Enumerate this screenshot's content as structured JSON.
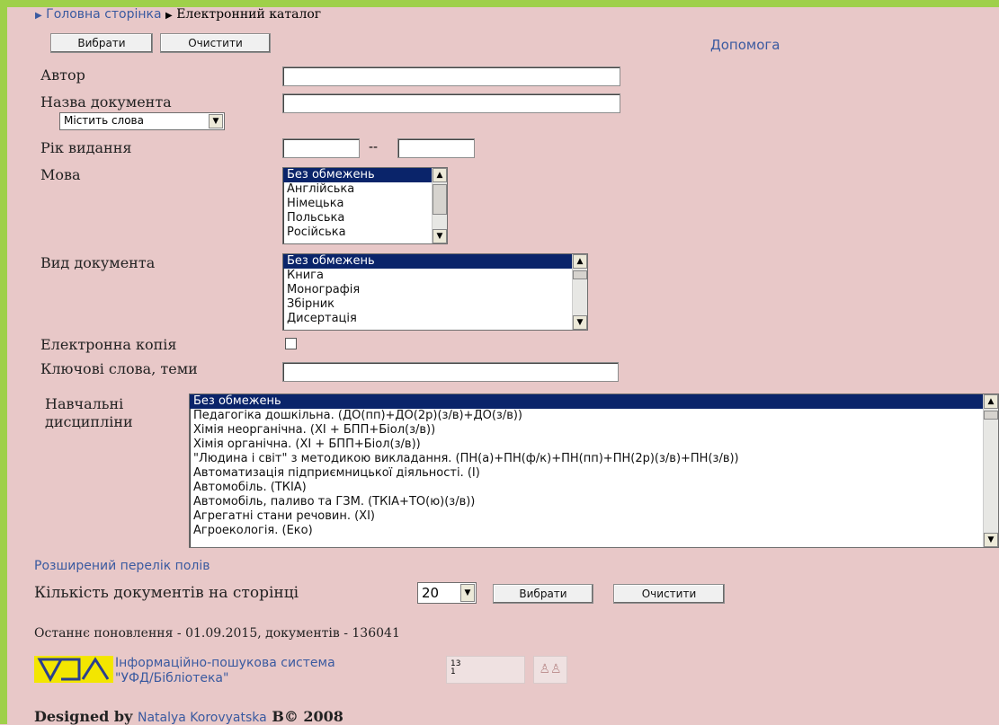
{
  "breadcrumb": {
    "home": "Головна сторінка",
    "current": "Електронний каталог"
  },
  "toolbar": {
    "select_label": "Вибрати",
    "clear_label": "Очистити",
    "help_label": "Допомога"
  },
  "fields": {
    "author_label": "Автор",
    "title_label": "Назва документа",
    "title_mode": "Містить слова",
    "year_label": "Рік видання",
    "year_sep": "--",
    "language_label": "Мова",
    "doctype_label": "Вид документа",
    "ecopy_label": "Електронна копія",
    "keywords_label": "Ключові слова, теми",
    "disciplines_label_line1": "Навчальні",
    "disciplines_label_line2": "дисципліни"
  },
  "languages": [
    "Без обмежень",
    "Англійська",
    "Німецька",
    "Польська",
    "Російська"
  ],
  "doctypes": [
    "Без обмежень",
    "Книга",
    "Монографія",
    "Збірник",
    "Дисертація"
  ],
  "disciplines": [
    "Без обмежень",
    "Педагогіка дошкільна. (ДО(пп)+ДО(2р)(з/в)+ДО(з/в))",
    "Хімія неорганічна. (ХІ + БПП+Біол(з/в))",
    "Хімія органічна. (ХІ + БПП+Біол(з/в))",
    "\"Людина і світ\" з методикою викладання. (ПН(а)+ПН(ф/к)+ПН(пп)+ПН(2р)(з/в)+ПН(з/в))",
    "Автоматизація підприємницької діяльності. (І)",
    "Автомобіль. (ТКІА)",
    "Автомобіль, паливо та ГЗМ. (ТКІА+ТО(ю)(з/в))",
    "Агрегатні стани речовин. (ХІ)",
    "Агроекологія. (Еко)"
  ],
  "extended_link": "Розширений перелік полів",
  "page_size": {
    "label": "Кількість документів на сторінці",
    "value": "20"
  },
  "bottom": {
    "select_label": "Вибрати",
    "clear_label": "Очистити"
  },
  "update_info": "Останнє поновлення - 01.09.2015, документів - 136041",
  "footer": {
    "system_line1": "Інформаційно-пошукова система",
    "system_line2": "\"УФД/Бібліотека\"",
    "counter_text": "13\n1",
    "designed_by": "Designed by",
    "designer": "Natalya Korovyatska",
    "copyright": "B© 2008"
  },
  "colors": {
    "background": "#e8c8c8",
    "accent_band": "#9fd04a",
    "link": "#3a5aa0",
    "selection": "#0a246a"
  }
}
